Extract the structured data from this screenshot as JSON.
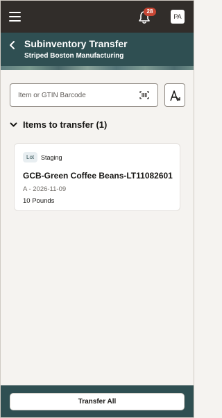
{
  "topbar": {
    "notification_count": "28",
    "avatar_initials": "PA"
  },
  "header": {
    "title": "Subinventory Transfer",
    "subtitle": "Striped Boston Manufacturing"
  },
  "search": {
    "placeholder": "Item or GTIN Barcode"
  },
  "section": {
    "title": "Items to transfer (1)"
  },
  "items": [
    {
      "badge": "Lot",
      "subinventory": "Staging",
      "name": "GCB-Green Coffee Beans-LT11082601",
      "meta": "A - 2026-11-09",
      "quantity": "10 Pounds"
    }
  ],
  "footer": {
    "transfer_all_label": "Transfer All"
  },
  "colors": {
    "topbar": "#312d2a",
    "header": "#2f4f52",
    "badge": "#c74634",
    "background": "#f5f3f0"
  },
  "icons": [
    "menu-icon",
    "bell-icon",
    "back-icon",
    "barcode-scan-icon",
    "sort-icon",
    "chevron-down-icon"
  ]
}
